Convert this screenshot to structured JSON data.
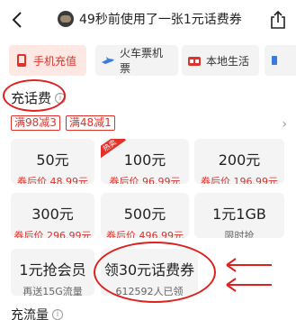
{
  "header": {
    "notice": "49秒前使用了一张1元话费券",
    "back_icon": "back-chevron-icon",
    "share_icon": "share-icon"
  },
  "tabs": [
    {
      "label": "手机充值",
      "icon": "phone-recharge-icon",
      "active": true
    },
    {
      "label": "火车票机票",
      "icon": "train-plane-icon",
      "active": false
    },
    {
      "label": "本地生活",
      "icon": "local-life-icon",
      "active": false
    }
  ],
  "section": {
    "title": "充话费",
    "info": "i"
  },
  "coupons": [
    "满98减3",
    "满48减1"
  ],
  "cards": [
    {
      "amount": "50元",
      "price": "券后价 48.99元",
      "badge": ""
    },
    {
      "amount": "100元",
      "price": "券后价 96.99元",
      "badge": "热卖"
    },
    {
      "amount": "200元",
      "price": "券后价 196.99元",
      "badge": ""
    },
    {
      "amount": "300元",
      "price": "券后价 296.99元",
      "badge": ""
    },
    {
      "amount": "500元",
      "price": "券后价 496.99元",
      "badge": ""
    },
    {
      "amount": "1元1GB",
      "price": "限时抢",
      "badge": ""
    },
    {
      "amount": "1元抢会员",
      "price": "再送15G流量",
      "badge": ""
    },
    {
      "amount": "领30元话费券",
      "price": "612592人已领",
      "badge": ""
    }
  ],
  "footer": {
    "title": "充流量"
  },
  "colors": {
    "accent": "#e0312a",
    "annotation": "#e02020",
    "card_bg": "#f4f4f4"
  }
}
